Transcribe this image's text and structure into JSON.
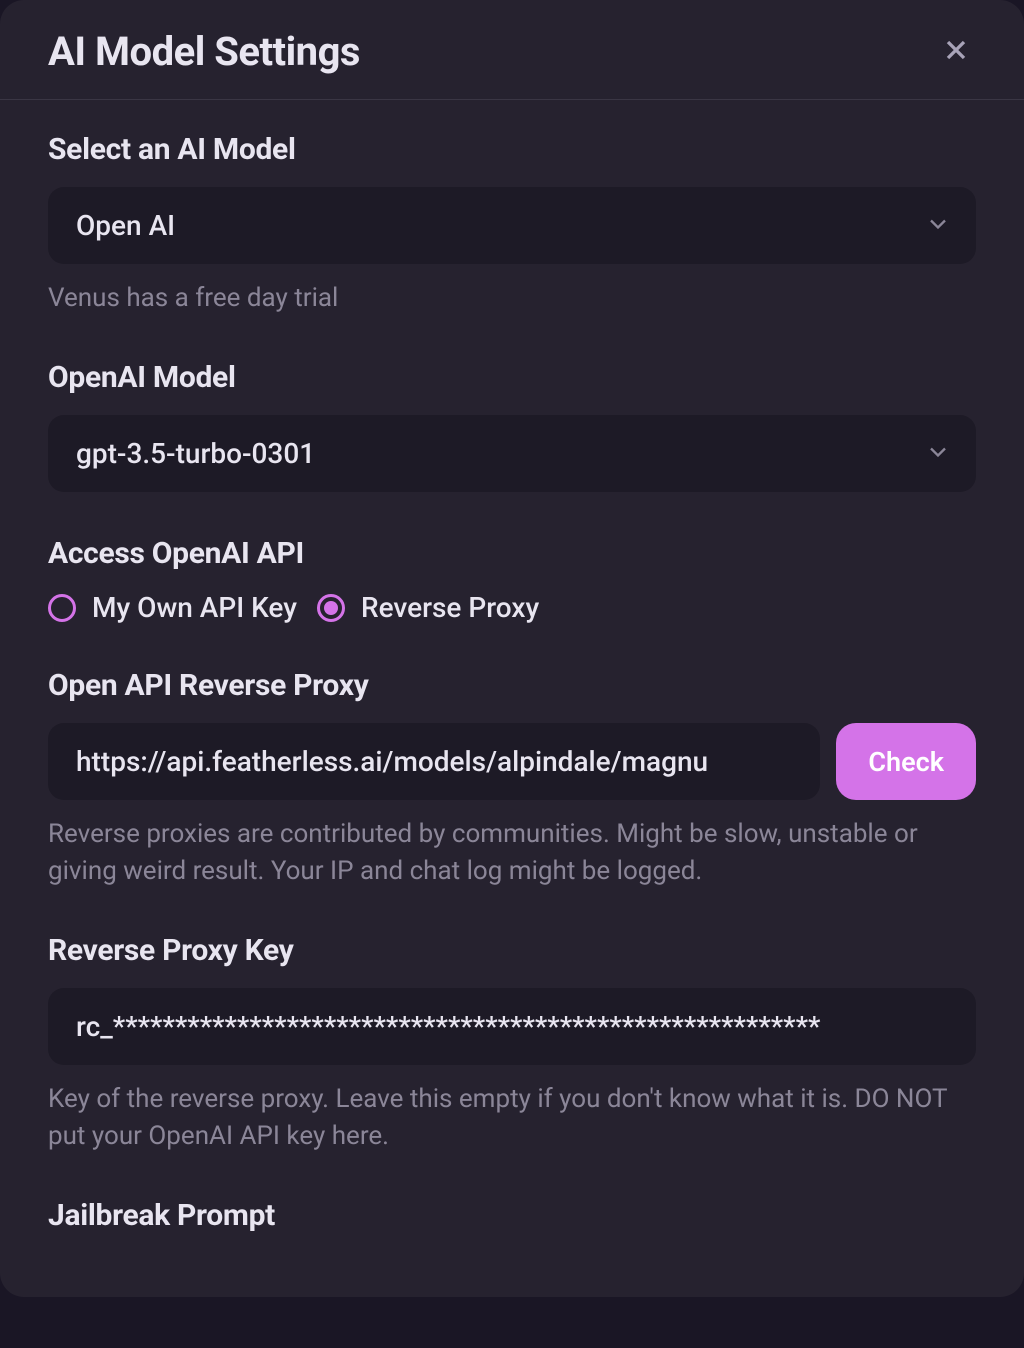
{
  "modal": {
    "title": "AI Model Settings"
  },
  "sections": {
    "selectModel": {
      "label": "Select an AI Model",
      "value": "Open AI",
      "help": "Venus has a free day trial"
    },
    "openaiModel": {
      "label": "OpenAI Model",
      "value": "gpt-3.5-turbo-0301"
    },
    "accessApi": {
      "label": "Access OpenAI API",
      "options": {
        "ownKey": "My Own API Key",
        "reverseProxy": "Reverse Proxy"
      },
      "selected": "reverseProxy"
    },
    "reverseProxy": {
      "label": "Open API Reverse Proxy",
      "value": "https://api.featherless.ai/models/alpindale/magnu",
      "checkButton": "Check",
      "help": "Reverse proxies are contributed by communities. Might be slow, unstable or giving weird result. Your IP and chat log might be logged."
    },
    "reverseProxyKey": {
      "label": "Reverse Proxy Key",
      "value": "rc_*********************************************************",
      "help": "Key of the reverse proxy. Leave this empty if you don't know what it is. DO NOT put your OpenAI API key here."
    },
    "jailbreak": {
      "label": "Jailbreak Prompt"
    }
  }
}
